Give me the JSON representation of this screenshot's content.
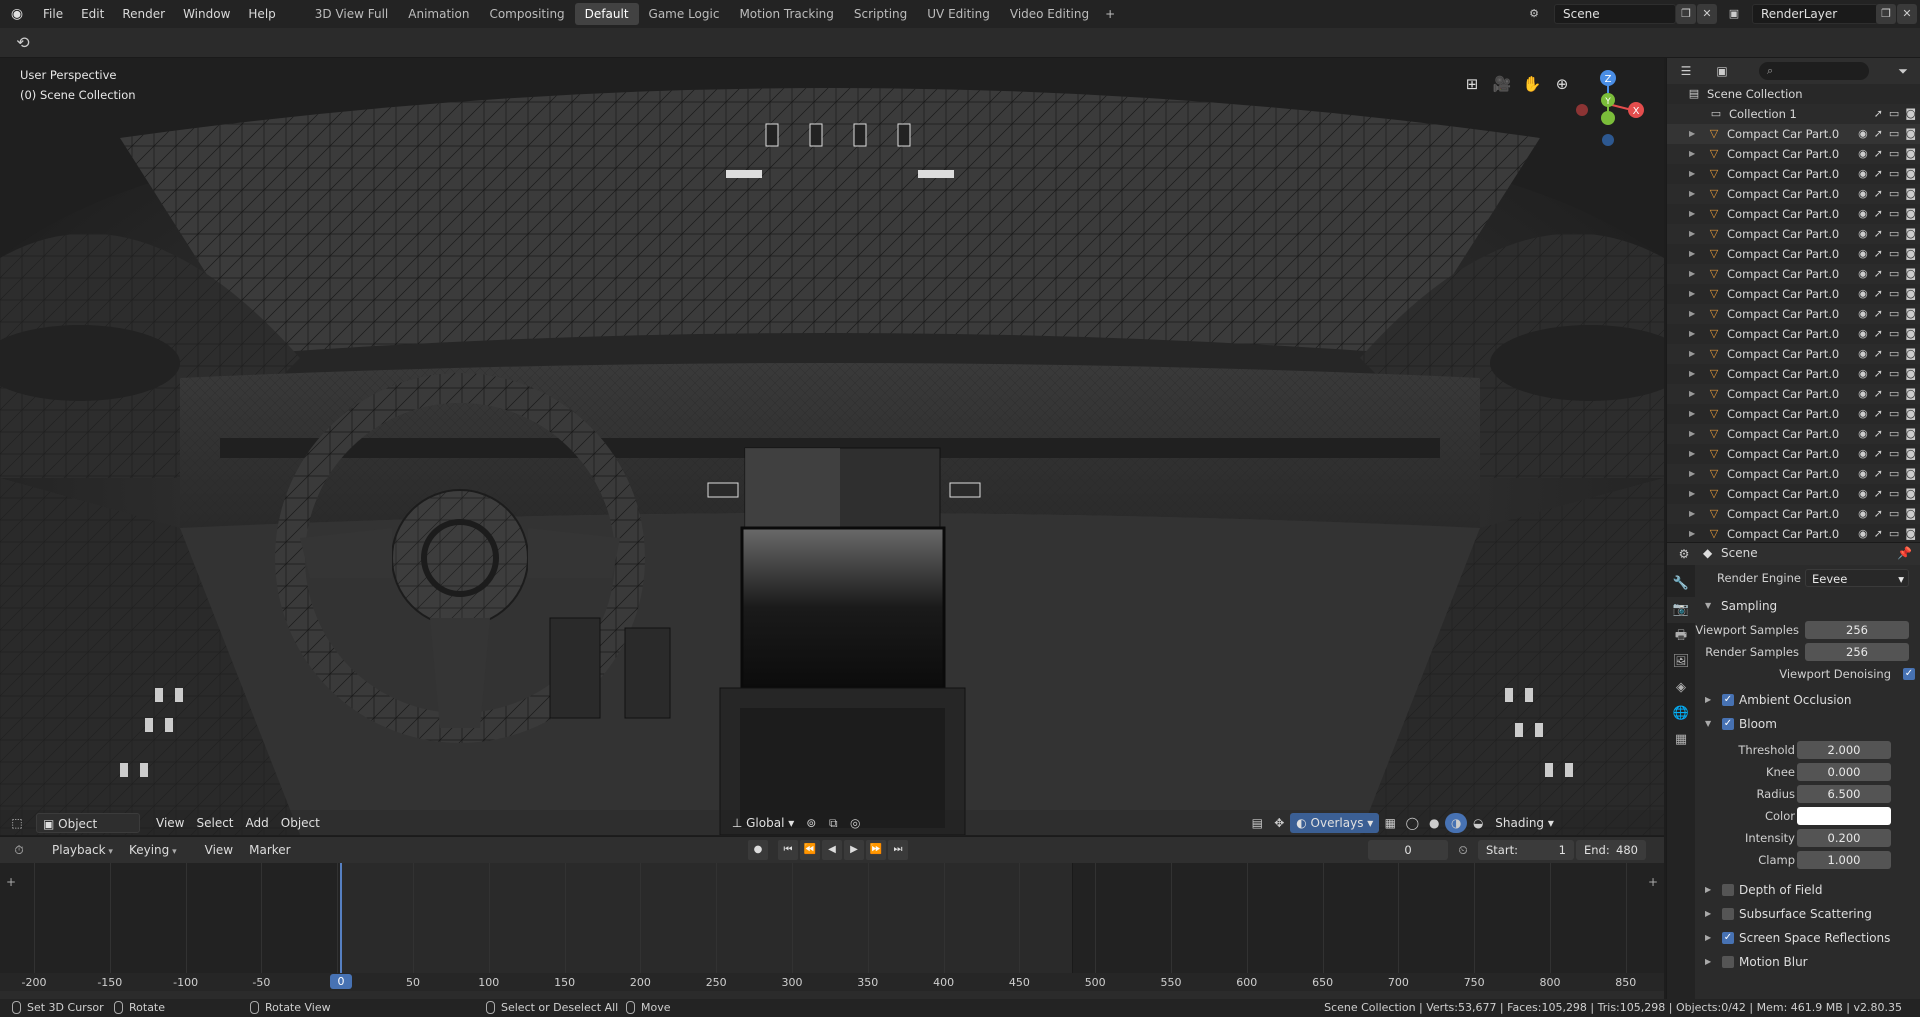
{
  "topbar": {
    "menus": [
      "File",
      "Edit",
      "Render",
      "Window",
      "Help"
    ],
    "workspaces": [
      "3D View Full",
      "Animation",
      "Compositing",
      "Default",
      "Game Logic",
      "Motion Tracking",
      "Scripting",
      "UV Editing",
      "Video Editing"
    ],
    "active_workspace": "Default",
    "scene_name": "Scene",
    "render_layer": "RenderLayer"
  },
  "viewport": {
    "perspective": "User Perspective",
    "collection": "(0) Scene Collection",
    "mode": "Object Mode",
    "menus": [
      "View",
      "Select",
      "Add",
      "Object"
    ],
    "transform_orientation": "Global",
    "overlays": "Overlays",
    "shading": "Shading",
    "gizmo_axes": [
      "X",
      "Y",
      "Z"
    ]
  },
  "timeline": {
    "menus": [
      "Playback",
      "Keying",
      "View",
      "Marker"
    ],
    "current_frame": "0",
    "start_label": "Start:",
    "start": "1",
    "end_label": "End:",
    "end": "480",
    "ruler_ticks": [
      "-200",
      "-150",
      "-100",
      "-50",
      "0",
      "50",
      "100",
      "150",
      "200",
      "250",
      "300",
      "350",
      "400",
      "450",
      "500",
      "550",
      "600",
      "650",
      "700",
      "750",
      "800",
      "850"
    ],
    "playhead_label": "0"
  },
  "outliner": {
    "root": "Scene Collection",
    "collection": "Collection 1",
    "items": [
      "Compact Car Part.0",
      "Compact Car Part.0",
      "Compact Car Part.0",
      "Compact Car Part.0",
      "Compact Car Part.0",
      "Compact Car Part.0",
      "Compact Car Part.0",
      "Compact Car Part.0",
      "Compact Car Part.0",
      "Compact Car Part.0",
      "Compact Car Part.0",
      "Compact Car Part.0",
      "Compact Car Part.0",
      "Compact Car Part.0",
      "Compact Car Part.0",
      "Compact Car Part.0",
      "Compact Car Part.0",
      "Compact Car Part.0",
      "Compact Car Part.0",
      "Compact Car Part.0",
      "Compact Car Part.0"
    ]
  },
  "properties": {
    "context": "Scene",
    "render_engine_label": "Render Engine",
    "render_engine": "Eevee",
    "sampling": "Sampling",
    "viewport_samples_label": "Viewport Samples",
    "viewport_samples": "256",
    "render_samples_label": "Render Samples",
    "render_samples": "256",
    "viewport_denoising_label": "Viewport Denoising",
    "ambient_occlusion": "Ambient Occlusion",
    "bloom": "Bloom",
    "threshold_label": "Threshold",
    "threshold": "2.000",
    "knee_label": "Knee",
    "knee": "0.000",
    "radius_label": "Radius",
    "radius": "6.500",
    "color_label": "Color",
    "intensity_label": "Intensity",
    "intensity": "0.200",
    "clamp_label": "Clamp",
    "clamp": "1.000",
    "depth_of_field": "Depth of Field",
    "subsurface_scattering": "Subsurface Scattering",
    "screen_space_reflections": "Screen Space Reflections",
    "motion_blur": "Motion Blur"
  },
  "statusbar": {
    "set_cursor": "Set 3D Cursor",
    "rotate": "Rotate",
    "rotate_view": "Rotate View",
    "select": "Select or Deselect All",
    "move": "Move",
    "stats": "Scene Collection | Verts:53,677 | Faces:105,298 | Tris:105,298 | Objects:0/42 | Mem: 461.9 MB | v2.80.35"
  },
  "colors": {
    "accent": "#4772b3",
    "object_icon": "#e59a3a",
    "axis_x": "#e44d4d",
    "axis_y": "#7bbd3a",
    "axis_z": "#4a8ee6"
  }
}
